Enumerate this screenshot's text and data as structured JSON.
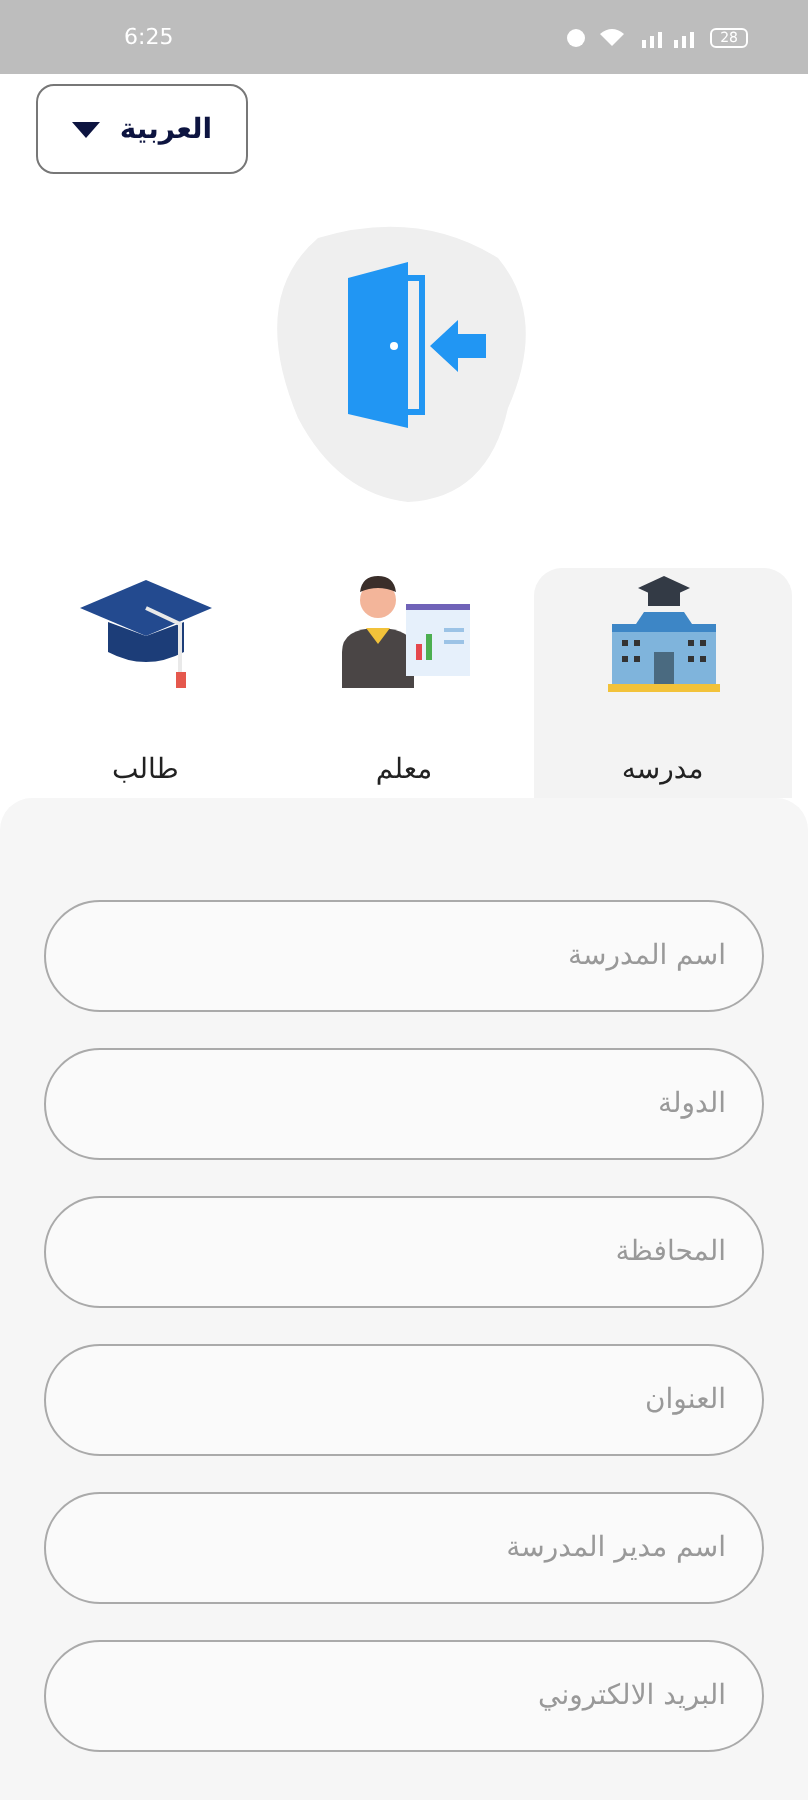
{
  "status_bar": {
    "time": "6:25",
    "battery": "28"
  },
  "language": {
    "value": "العربية"
  },
  "roles": [
    {
      "label": "مدرسه",
      "kind": "school",
      "selected": true
    },
    {
      "label": "معلم",
      "kind": "teacher",
      "selected": false
    },
    {
      "label": "طالب",
      "kind": "student",
      "selected": false
    }
  ],
  "fields": [
    {
      "placeholder": "اسم المدرسة"
    },
    {
      "placeholder": "الدولة"
    },
    {
      "placeholder": "المحافظة"
    },
    {
      "placeholder": "العنوان"
    },
    {
      "placeholder": "اسم مدير المدرسة"
    },
    {
      "placeholder": "البريد الالكتروني"
    }
  ]
}
